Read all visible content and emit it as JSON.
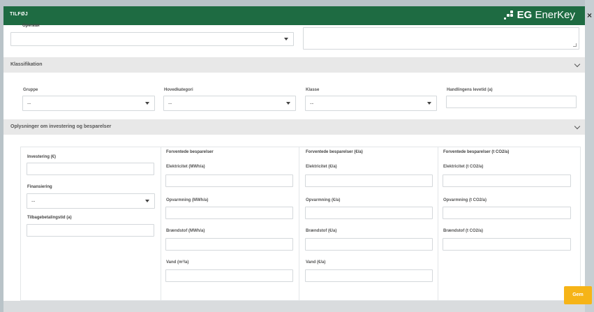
{
  "modal": {
    "title": "TILFØJ",
    "brand_mark": "EG",
    "brand_name": "EnerKey",
    "close_glyph": "×"
  },
  "top": {
    "partial_label": "Operatør",
    "select_value": ""
  },
  "klassifikation": {
    "title": "Klassifikation",
    "gruppe": {
      "label": "Gruppe",
      "value": "--"
    },
    "hovedkategori": {
      "label": "Hovedkategori",
      "value": "--"
    },
    "klasse": {
      "label": "Klasse",
      "value": "--"
    },
    "levetid": {
      "label": "Handlingens levetid (a)",
      "value": ""
    }
  },
  "oplysninger": {
    "title": "Oplysninger om investering og besparelser",
    "col1": {
      "investering_label": "Investering (€)",
      "finansiering_label": "Finansiering",
      "finansiering_value": "--",
      "tilbagebetaling_label": "Tilbagebetalingstid (a)"
    },
    "col2": {
      "heading": "Forventede besparelser",
      "fields": [
        "Elektricitet (MWh/a)",
        "Opvarmning (MWh/a)",
        "Brændstof (MWh/a)",
        "Vand (m³/a)"
      ]
    },
    "col3": {
      "heading": "Forventede besparelser (€/a)",
      "fields": [
        "Elektricitet (€/a)",
        "Opvarmning (€/a)",
        "Brændstof (€/a)",
        "Vand (€/a)"
      ]
    },
    "col4": {
      "heading": "Forventede besparelser (t CO2/a)",
      "fields": [
        "Elektricitet (t CO2/a)",
        "Opvarmning (t CO2/a)",
        "Brændstof (t CO2/a)"
      ]
    }
  },
  "footer": {
    "save_label": "Gem"
  },
  "colors": {
    "header": "#1e6b42",
    "save": "#f6b417",
    "section": "#e8e8e8"
  }
}
